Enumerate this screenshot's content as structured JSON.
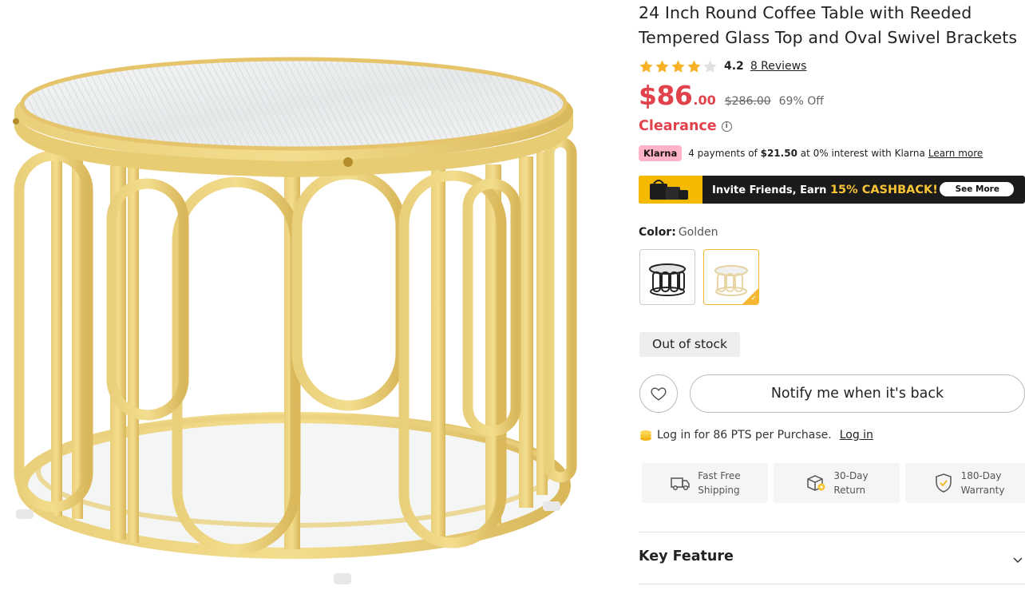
{
  "product": {
    "title": "24 Inch Round Coffee Table with Reeded Tempered Glass Top and Oval Swivel Brackets",
    "rating": "4.2",
    "rating_stars_filled": 4,
    "rating_stars_total": 5,
    "reviews_label": "8 Reviews",
    "price_main": "$86",
    "price_cents": ".00",
    "price_old": "$286.00",
    "discount": "69% Off",
    "clearance_label": "Clearance",
    "accent_color": "#e2424b"
  },
  "klarna": {
    "badge": "Klarna",
    "text_prefix": "4 payments of",
    "amount": "$21.50",
    "text_suffix": "at 0% interest with Klarna",
    "learn_more": "Learn more"
  },
  "promo": {
    "text": "Invite Friends, Earn",
    "highlight": "15% CASHBACK!",
    "button": "See More"
  },
  "color": {
    "label": "Color:",
    "value": "Golden",
    "options": [
      {
        "name": "black-option",
        "selected": false
      },
      {
        "name": "golden-option",
        "selected": true
      }
    ]
  },
  "stock_status": "Out of stock",
  "notify_label": "Notify me when it's back",
  "points": {
    "text": "Log in for 86 PTS per Purchase.",
    "login": "Log in"
  },
  "services": [
    {
      "line1": "Fast Free",
      "line2": "Shipping",
      "icon": "truck-icon"
    },
    {
      "line1": "30-Day",
      "line2": "Return",
      "icon": "return-box-icon"
    },
    {
      "line1": "180-Day",
      "line2": "Warranty",
      "icon": "shield-check-icon"
    }
  ],
  "key_feature_label": "Key Feature"
}
